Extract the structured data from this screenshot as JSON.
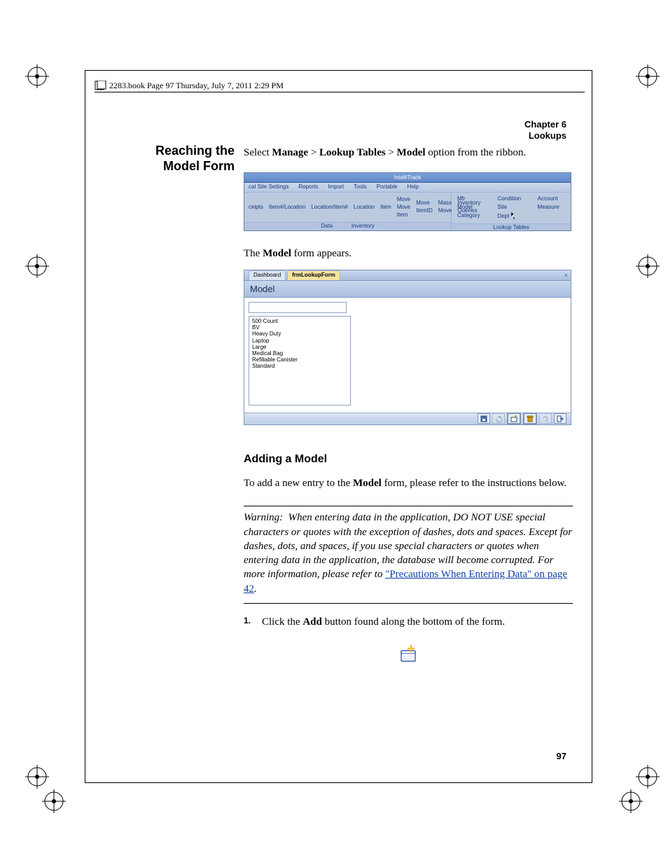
{
  "book_header": "2283.book  Page 97  Thursday, July 7, 2011  2:29 PM",
  "chapter": {
    "line1": "Chapter 6",
    "line2": "Lookups"
  },
  "sidebar_title": "Reaching the Model Form",
  "intro": {
    "pre": "Select ",
    "b1": "Manage",
    "sep1": " > ",
    "b2": "Lookup Tables",
    "sep2": " > ",
    "b3": "Model",
    "post": " option from the ribbon."
  },
  "ribbon": {
    "title": "IntelliTrack",
    "tabs": [
      "cal Site Settings",
      "Reports",
      "Import",
      "Tools",
      "Portable",
      "Help"
    ],
    "left_items": [
      "ceipts",
      "Item#/Location",
      "Location/Item#",
      "Location",
      "Item",
      "Move Move Item",
      "Move ItemID",
      "Mass Move",
      "Inventory Queries"
    ],
    "left_foot": "Data",
    "left_foot2": "Inventory",
    "right_grid": [
      "Mfr",
      "Condition",
      "Account",
      "Model",
      "Site",
      "Measure",
      "Category",
      "Dept",
      ""
    ],
    "right_foot": "Lookup Tables"
  },
  "appears": {
    "pre": "The ",
    "b": "Model",
    "post": " form appears."
  },
  "form": {
    "tab1": "Dashboard",
    "tab2": "frmLookupForm",
    "title": "Model",
    "items": [
      "500 Count",
      "BV",
      "Heavy Duty",
      "Laptop",
      "Large",
      "Medical Bag",
      "Refillable Canister",
      "Standard"
    ]
  },
  "section": "Adding a Model",
  "add_intro": {
    "pre": "To add a new entry to the ",
    "b": "Model",
    "post": " form, please refer to the instructions below."
  },
  "warning": {
    "label": "Warning:",
    "body1": "When entering data in the application, DO NOT USE special characters or quotes with the exception of dashes, dots and spaces. Except for dashes, dots, and spaces, if you use special characters or quotes when entering data in the application, the database will become corrupted. For more information, please refer to ",
    "link": "\"Precautions When Entering Data\" on page 42",
    "tail": "."
  },
  "step1": {
    "num": "1.",
    "pre": "Click the ",
    "b": "Add",
    "post": " button found along the bottom of the form."
  },
  "page_number": "97"
}
